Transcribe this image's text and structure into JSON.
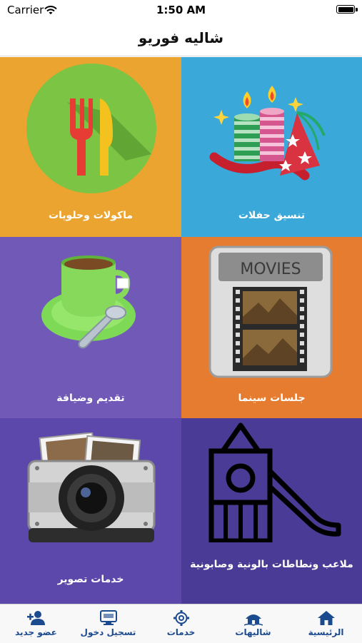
{
  "status_bar": {
    "carrier": "Carrier",
    "time": "1:50 AM"
  },
  "nav": {
    "title": "شاليه فوريو"
  },
  "tiles": [
    {
      "label": "تنسيق حفلات",
      "color": "#3aa8d8",
      "icon": "birthday-candles-icon"
    },
    {
      "label": "ماكولات وحلويات",
      "color": "#eba430",
      "icon": "fork-knife-icon"
    },
    {
      "label": "جلسات سينما",
      "color": "#e57c30",
      "icon": "movie-film-icon"
    },
    {
      "label": "تقديم وضيافة",
      "color": "#7159b8",
      "icon": "coffee-cup-icon"
    },
    {
      "label": "ملاعب ونطاطات بالونية وصابونية",
      "color": "#4a3c96",
      "icon": "playground-slide-icon"
    },
    {
      "label": "خدمات تصوير",
      "color": "#5c47ab",
      "icon": "camera-icon"
    }
  ],
  "movies_sign": "MOVIES",
  "tab_bar": {
    "active_color": "#1b4a8f",
    "items": [
      {
        "label": "الرئيسية",
        "icon": "home-icon"
      },
      {
        "label": "شاليهات",
        "icon": "chalet-icon"
      },
      {
        "label": "خدمات",
        "icon": "gear-icon"
      },
      {
        "label": "تسجيل دخول",
        "icon": "login-monitor-icon"
      },
      {
        "label": "عضو جديد",
        "icon": "add-user-icon"
      }
    ]
  }
}
